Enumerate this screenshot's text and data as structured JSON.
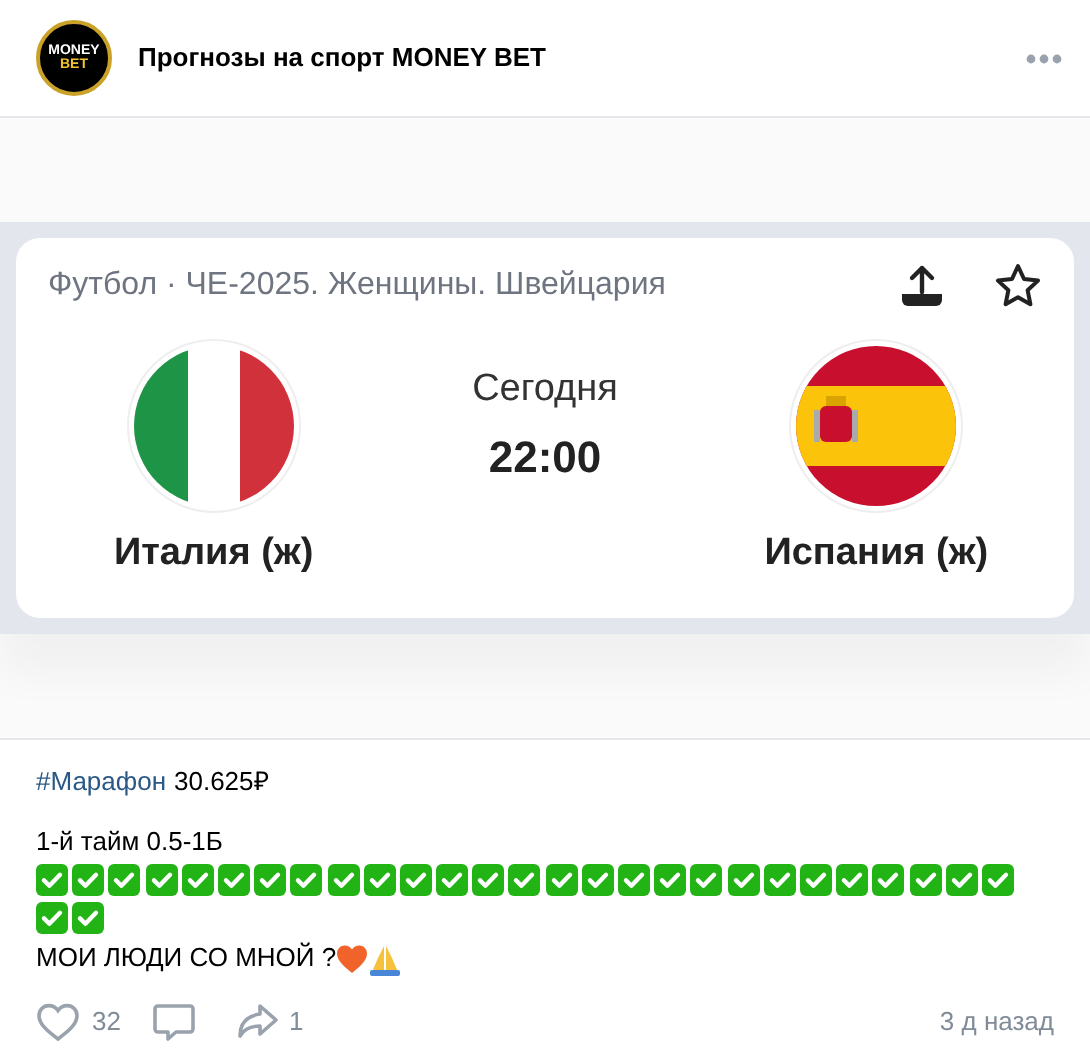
{
  "header": {
    "logo_text": [
      "MONEY",
      "BET"
    ],
    "title": "Прогнозы на спорт MONEY BET"
  },
  "match_card": {
    "subtitle": "Футбол · ЧЕ-2025. Женщины. Швейцария",
    "day": "Сегодня",
    "time": "22:00",
    "teams": [
      {
        "name": "Италия (ж)",
        "kind": "italy"
      },
      {
        "name": "Испания (ж)",
        "kind": "spain"
      }
    ]
  },
  "post": {
    "hashtag": "#Марафон",
    "amount": "30.625₽",
    "line": "1-й тайм 0.5-1Б",
    "marks": [
      {
        "kind": "check"
      },
      {
        "kind": "check"
      },
      {
        "kind": "check"
      },
      {
        "kind": "check"
      },
      {
        "kind": "check"
      },
      {
        "kind": "check"
      },
      {
        "kind": "check"
      },
      {
        "kind": "check"
      },
      {
        "kind": "check"
      },
      {
        "kind": "check"
      },
      {
        "kind": "check"
      },
      {
        "kind": "check"
      },
      {
        "kind": "check"
      },
      {
        "kind": "check"
      },
      {
        "kind": "check"
      },
      {
        "kind": "check"
      },
      {
        "kind": "check"
      },
      {
        "kind": "check"
      },
      {
        "kind": "check"
      },
      {
        "kind": "check"
      },
      {
        "kind": "check"
      },
      {
        "kind": "check"
      },
      {
        "kind": "check"
      },
      {
        "kind": "check"
      },
      {
        "kind": "check"
      },
      {
        "kind": "check"
      },
      {
        "kind": "check"
      },
      {
        "kind": "check"
      },
      {
        "kind": "check"
      }
    ],
    "closing": "МОИ ЛЮДИ СО МНОЙ ?",
    "closing_emojis": [
      {
        "kind": "heart"
      },
      {
        "kind": "pray"
      }
    ]
  },
  "footer": {
    "likes": "32",
    "reposts": "1",
    "time": "3 д назад"
  }
}
